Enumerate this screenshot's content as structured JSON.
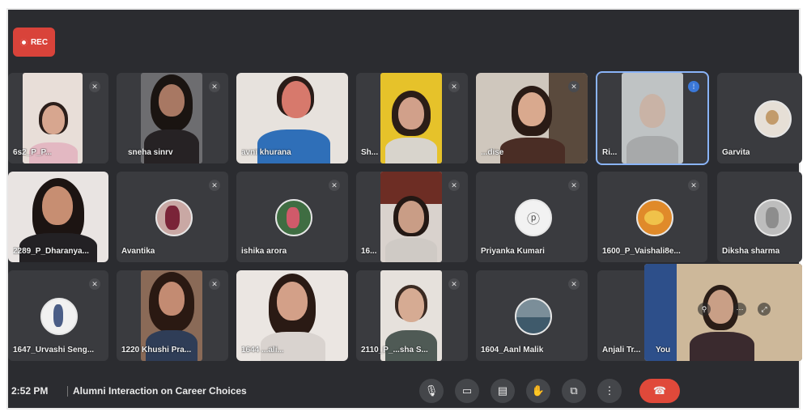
{
  "recording": {
    "label": "REC"
  },
  "participants": [
    {
      "name": "6s2_P_P..."
    },
    {
      "name": "sneha sinrv"
    },
    {
      "name": "avni khurana"
    },
    {
      "name": "Sh..."
    },
    {
      "name": "...dise"
    },
    {
      "name": "Ri..."
    },
    {
      "name": "Garvita"
    },
    {
      "name": "2289_P_Dharanya..."
    },
    {
      "name": "Avantika"
    },
    {
      "name": "ishika arora"
    },
    {
      "name": "16..."
    },
    {
      "name": "Priyanka Kumari"
    },
    {
      "name": "1600_P_Vaishali8e..."
    },
    {
      "name": "Diksha sharma"
    },
    {
      "name": "1647_Urvashi Seng..."
    },
    {
      "name": "1220 Khushi Pra..."
    },
    {
      "name": "1644 ...ali..."
    },
    {
      "name": "2110_P_...sha S..."
    },
    {
      "name": "1604_Aanl Malik"
    },
    {
      "name": "Anjali Tr..."
    },
    {
      "name": "You"
    }
  ],
  "bottom_bar": {
    "time": "2:52 PM",
    "meeting_title": "Alumni Interaction on Career Choices"
  },
  "icons": {
    "mic": "mic-off-icon",
    "pin": "pin-icon",
    "record": "record-dot-icon"
  },
  "colors": {
    "end_call": "#e0493a",
    "rec": "#d9433a",
    "active_border": "#8ab4f8"
  }
}
